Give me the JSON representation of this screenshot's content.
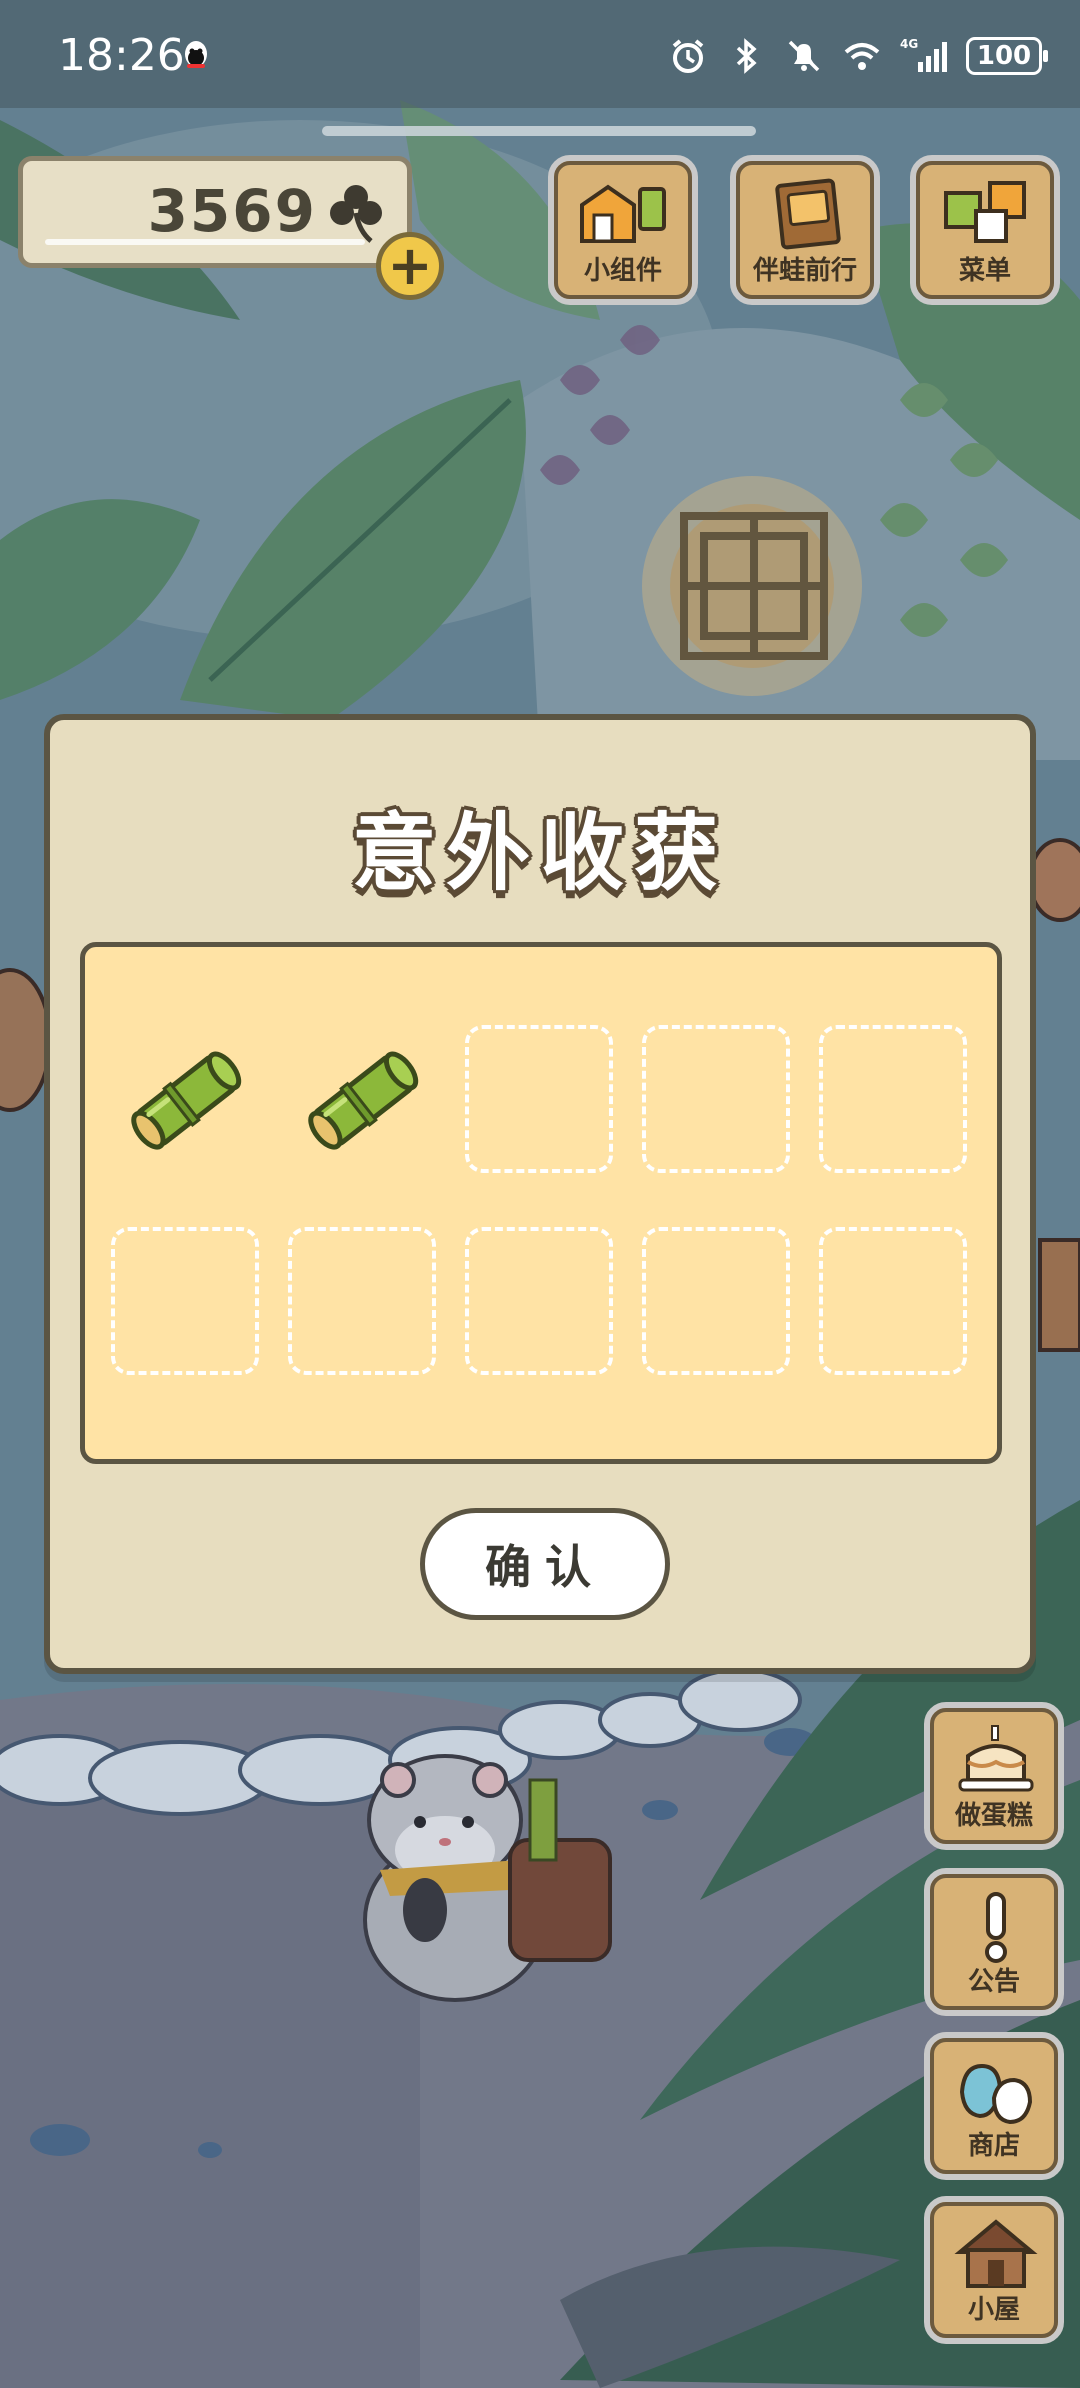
{
  "status_bar": {
    "time": "18:26",
    "network": "4G",
    "battery": "100",
    "icons": [
      "qq-icon",
      "alarm-icon",
      "bluetooth-icon",
      "mute-icon",
      "wifi-icon",
      "signal-icon",
      "battery-icon"
    ]
  },
  "currency": {
    "clover_count": "3569",
    "icon": "clover-icon",
    "add_icon": "plus-icon"
  },
  "top_buttons": [
    {
      "label": "小组件",
      "icon": "widget-icon"
    },
    {
      "label": "伴蛙前行",
      "icon": "book-icon"
    },
    {
      "label": "菜单",
      "icon": "menu-icon"
    }
  ],
  "side_buttons": [
    {
      "label": "做蛋糕",
      "icon": "cake-icon"
    },
    {
      "label": "公告",
      "icon": "exclamation-icon"
    },
    {
      "label": "商店",
      "icon": "shop-bag-icon"
    },
    {
      "label": "小屋",
      "icon": "house-icon"
    }
  ],
  "dialog": {
    "title": "意外收获",
    "slots": [
      {
        "item": "bamboo-icon"
      },
      {
        "item": "bamboo-icon"
      },
      {
        "item": null
      },
      {
        "item": null
      },
      {
        "item": null
      },
      {
        "item": null
      },
      {
        "item": null
      },
      {
        "item": null
      },
      {
        "item": null
      },
      {
        "item": null
      }
    ],
    "confirm_label": "确认"
  },
  "colors": {
    "dialog_bg": "#e7ddbf",
    "panel_bg": "#ffe3a5",
    "border": "#5b5543",
    "wood": "#d8b276",
    "clover_add": "#f0c84a"
  }
}
